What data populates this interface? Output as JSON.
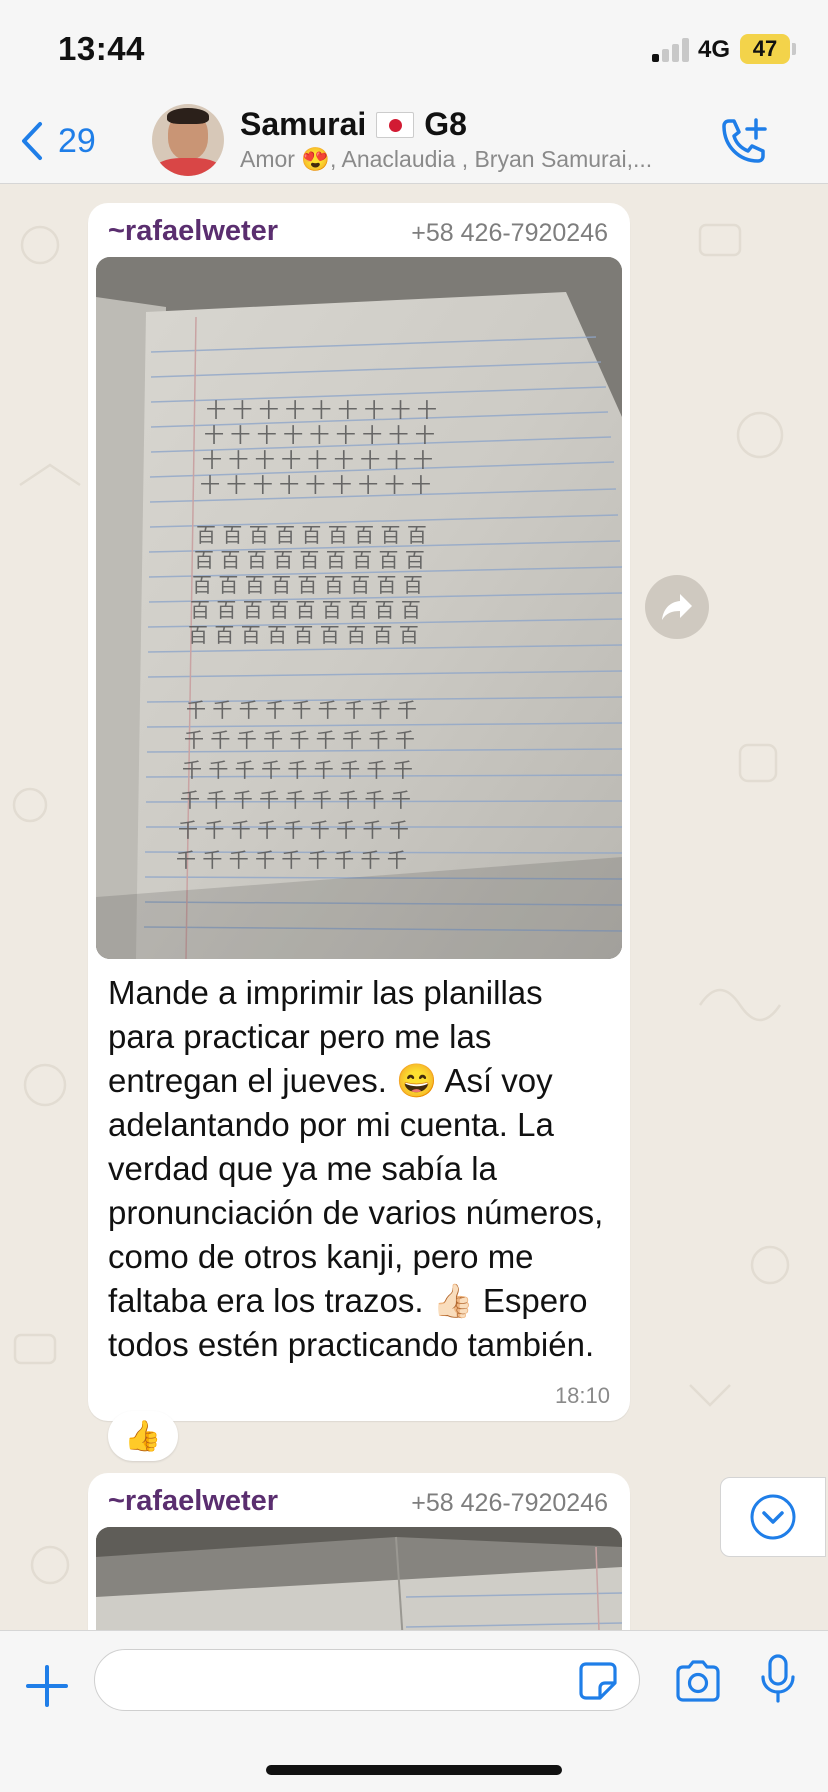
{
  "status_bar": {
    "time": "13:44",
    "network": "4G",
    "battery": "47"
  },
  "header": {
    "back_count": "29",
    "title": "Samurai",
    "title_suffix": "G8",
    "subtitle": "Amor 😍, Anaclaudia , Bryan Samurai,..."
  },
  "messages": [
    {
      "sender": "~rafaelweter",
      "phone": "+58 426-7920246",
      "text": "Mande a imprimir las planillas para practicar pero me las entregan el jueves. 😄 Así voy adelantando por mi cuenta. La verdad que ya me sabía la pronunciación de varios números, como de otros kanji, pero me faltaba era los trazos. 👍🏻 Espero todos estén practicando también.",
      "time": "18:10",
      "reaction": "👍"
    },
    {
      "sender": "~rafaelweter",
      "phone": "+58 426-7920246"
    }
  ],
  "icons": {
    "back": "chevron-left-icon",
    "call": "add-call-icon",
    "forward": "forward-arrow-icon",
    "scroll": "chevron-down-circle-icon",
    "plus": "plus-icon",
    "sticker": "sticker-icon",
    "camera": "camera-icon",
    "mic": "microphone-icon"
  },
  "colors": {
    "accent": "#1f7ee8",
    "sender": "#5a2e6f",
    "chat_background": "#efeae2",
    "battery": "#f3d34a"
  }
}
